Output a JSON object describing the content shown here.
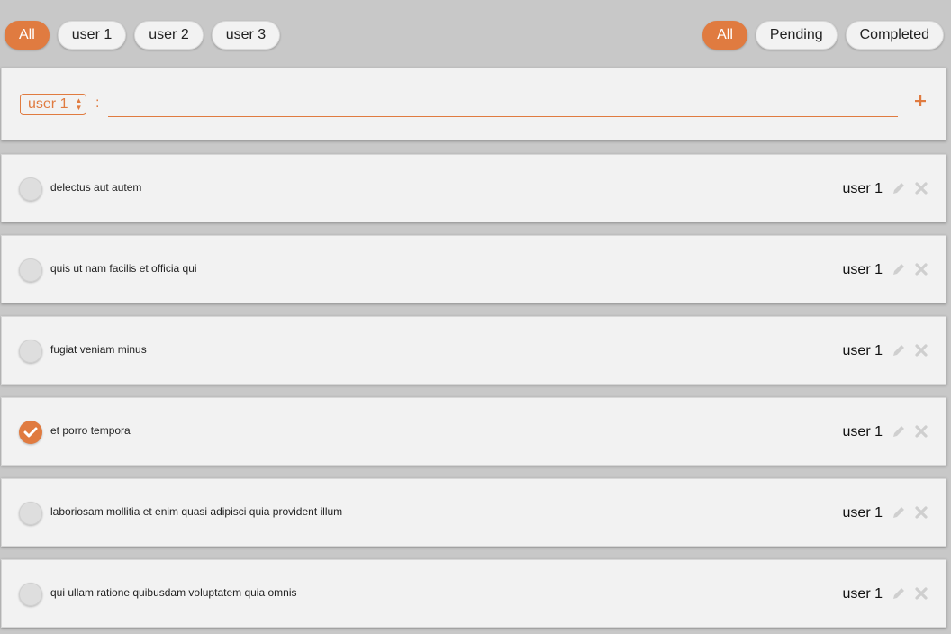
{
  "filters": {
    "users": [
      {
        "label": "All",
        "active": true
      },
      {
        "label": "user 1",
        "active": false
      },
      {
        "label": "user 2",
        "active": false
      },
      {
        "label": "user 3",
        "active": false
      }
    ],
    "status": [
      {
        "label": "All",
        "active": true
      },
      {
        "label": "Pending",
        "active": false
      },
      {
        "label": "Completed",
        "active": false
      }
    ]
  },
  "composer": {
    "selected_user": "user 1",
    "separator": ":",
    "input_value": "",
    "add_icon": "plus-icon"
  },
  "todos": [
    {
      "text": "delectus aut autem",
      "user": "user 1",
      "completed": false
    },
    {
      "text": "quis ut nam facilis et officia qui",
      "user": "user 1",
      "completed": false
    },
    {
      "text": "fugiat veniam minus",
      "user": "user 1",
      "completed": false
    },
    {
      "text": "et porro tempora",
      "user": "user 1",
      "completed": true
    },
    {
      "text": "laboriosam mollitia et enim quasi adipisci quia provident illum",
      "user": "user 1",
      "completed": false
    },
    {
      "text": "qui ullam ratione quibusdam voluptatem quia omnis",
      "user": "user 1",
      "completed": false
    }
  ],
  "icons": {
    "edit": "pencil-icon",
    "delete": "close-icon",
    "done": "check-icon"
  },
  "colors": {
    "accent": "#e07b40",
    "background": "#c8c8c8",
    "card": "#f2f2f2",
    "icon_gray": "#cfcfcf"
  }
}
